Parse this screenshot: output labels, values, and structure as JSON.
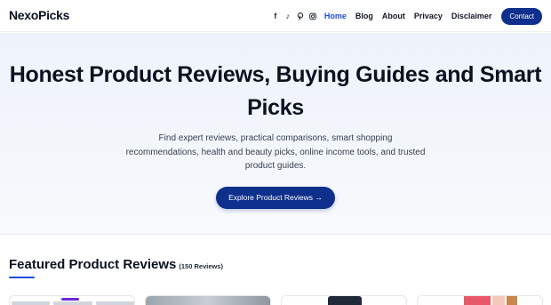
{
  "header": {
    "logo": "NexoPicks",
    "social": [
      {
        "icon": "facebook-icon",
        "glyph": "f"
      },
      {
        "icon": "tiktok-icon",
        "glyph": "♪"
      },
      {
        "icon": "pinterest-icon",
        "glyph": "P"
      },
      {
        "icon": "instagram-icon",
        "glyph": ""
      }
    ],
    "nav": [
      {
        "label": "Home",
        "active": true
      },
      {
        "label": "Blog",
        "active": false
      },
      {
        "label": "About",
        "active": false
      },
      {
        "label": "Privacy",
        "active": false
      },
      {
        "label": "Disclaimer",
        "active": false
      }
    ],
    "contact_label": "Contact"
  },
  "hero": {
    "title": "Honest Product Reviews, Buying Guides and Smart Picks",
    "subtitle": "Find expert reviews, practical comparisons, smart shopping recommendations, health and beauty picks, online income tools, and trusted product guides.",
    "cta_label": "Explore Product Reviews →"
  },
  "featured": {
    "title": "Featured Product Reviews",
    "count": "(150 Reviews)"
  },
  "colors": {
    "brand": "#0f2f8c",
    "active_link": "#1d4ed8",
    "hero_bg": "#eef3fb"
  }
}
